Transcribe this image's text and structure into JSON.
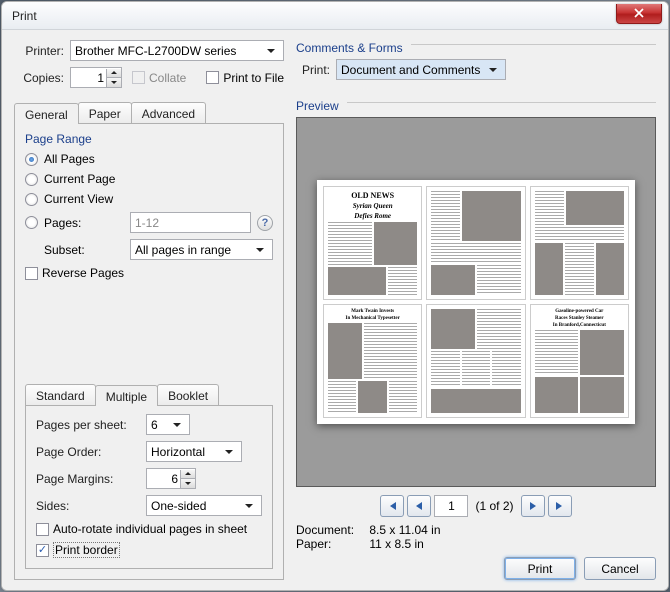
{
  "window": {
    "title": "Print"
  },
  "printer": {
    "label": "Printer:",
    "value": "Brother MFC-L2700DW series"
  },
  "copies": {
    "label": "Copies:",
    "value": "1"
  },
  "collate": {
    "label": "Collate",
    "disabled": true,
    "checked": false
  },
  "printToFile": {
    "label": "Print to File",
    "checked": false
  },
  "commentsForms": {
    "section": "Comments & Forms",
    "label": "Print:",
    "value": "Document and Comments"
  },
  "mainTabs": {
    "general": "General",
    "paper": "Paper",
    "advanced": "Advanced"
  },
  "pageRange": {
    "section": "Page Range",
    "allPages": "All Pages",
    "currentPage": "Current Page",
    "currentView": "Current View",
    "pagesLabel": "Pages:",
    "pagesValue": "1-12",
    "subsetLabel": "Subset:",
    "subsetValue": "All pages in range",
    "reversePages": "Reverse Pages",
    "selected": "allPages"
  },
  "handlingTabs": {
    "standard": "Standard",
    "multiple": "Multiple",
    "booklet": "Booklet"
  },
  "multiple": {
    "pagesPerSheetLabel": "Pages per sheet:",
    "pagesPerSheetValue": "6",
    "pageOrderLabel": "Page Order:",
    "pageOrderValue": "Horizontal",
    "pageMarginsLabel": "Page Margins:",
    "pageMarginsValue": "6",
    "sidesLabel": "Sides:",
    "sidesValue": "One-sided",
    "autoRotate": "Auto-rotate individual pages in sheet",
    "autoRotateChecked": false,
    "printBorder": "Print border",
    "printBorderChecked": true
  },
  "preview": {
    "section": "Preview",
    "pageNum": "1",
    "pageCountText": "(1 of 2)",
    "documentLabel": "Document:",
    "documentSize": "8.5 x 11.04 in",
    "paperLabel": "Paper:",
    "paperSize": "11 x 8.5 in",
    "thumbnails": {
      "t1": {
        "headline1": "OLD NEWS",
        "headline2": "Syrian Queen",
        "headline3": "Defies Rome"
      },
      "t4": {
        "headline2": "Mark Twain Invests",
        "headline3": "In Mechanical Typesetter"
      },
      "t6": {
        "headline2": "Gasoline-powered Car",
        "headline3": "Races Stanley Steamer",
        "headline4": "In Branford,Connecticut"
      }
    }
  },
  "buttons": {
    "print": "Print",
    "cancel": "Cancel"
  }
}
